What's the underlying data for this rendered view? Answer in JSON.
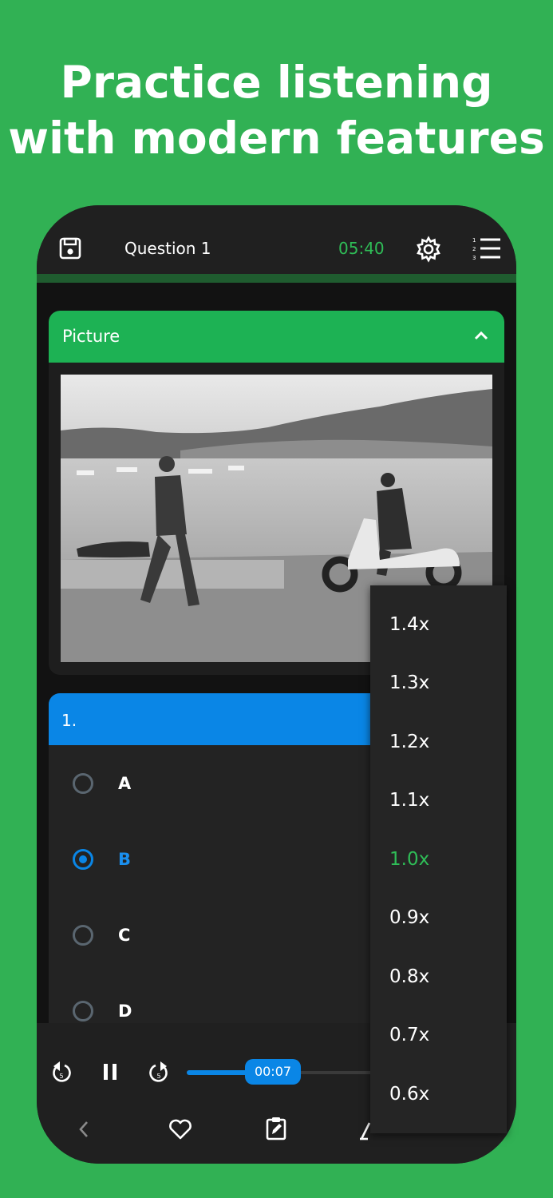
{
  "headline": {
    "line1": "Practice listening",
    "line2": "with modern features"
  },
  "topbar": {
    "title": "Question 1",
    "timer": "05:40",
    "icons": [
      "save-icon",
      "gear-icon",
      "numbered-list-icon"
    ]
  },
  "picture_card": {
    "label": "Picture",
    "collapse_icon": "chevron-up-icon"
  },
  "question": {
    "number": "1.",
    "options": [
      {
        "label": "A",
        "selected": false
      },
      {
        "label": "B",
        "selected": true
      },
      {
        "label": "C",
        "selected": false
      },
      {
        "label": "D",
        "selected": false
      }
    ]
  },
  "player": {
    "current_time": "00:07",
    "progress": 0.3,
    "replay_seconds": "5",
    "forward_seconds": "5"
  },
  "bottom_nav": {
    "icons": [
      "chevron-left-icon",
      "heart-icon",
      "edit-clipboard-icon",
      "pen-icon"
    ]
  },
  "speed_menu": {
    "items": [
      "1.4x",
      "1.3x",
      "1.2x",
      "1.1x",
      "1.0x",
      "0.9x",
      "0.8x",
      "0.7x",
      "0.6x"
    ],
    "selected": "1.0x"
  },
  "colors": {
    "background": "#31b154",
    "accent_green": "#1db254",
    "accent_blue": "#0a86e6",
    "dark": "#121212"
  }
}
